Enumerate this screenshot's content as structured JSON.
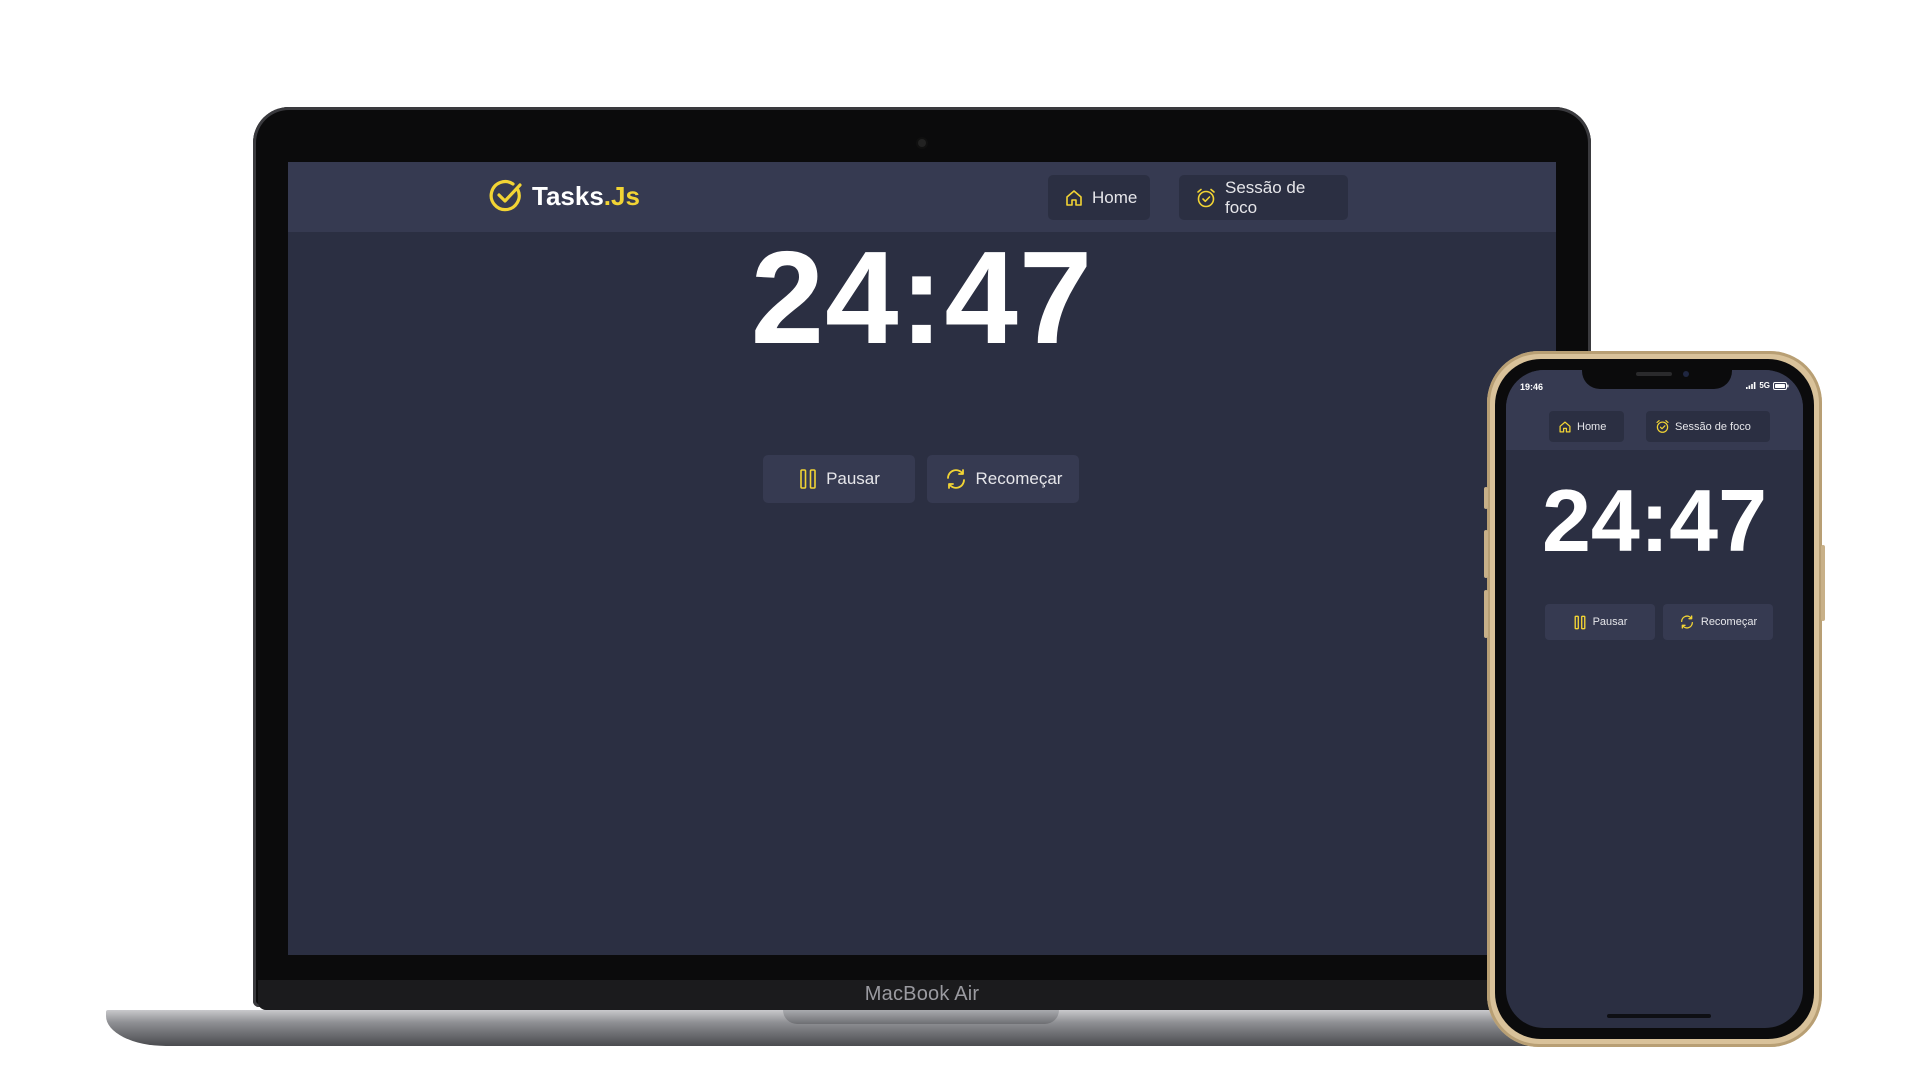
{
  "colors": {
    "background": "#2b2f42",
    "header": "#363a51",
    "accent": "#f2d434",
    "text": "#ffffff"
  },
  "app": {
    "logo_main": "Tasks",
    "logo_accent": ".Js",
    "nav": {
      "home_label": "Home",
      "focus_label": "Sessão de foco"
    },
    "timer": "24:47",
    "controls": {
      "pause_label": "Pausar",
      "restart_label": "Recomeçar"
    },
    "icons": [
      "check-circle-icon",
      "home-icon",
      "alarm-clock-icon",
      "pause-icon",
      "refresh-icon"
    ]
  },
  "laptop": {
    "brand": "MacBook Air"
  },
  "phone": {
    "status_time": "19:46",
    "network": "5G"
  }
}
